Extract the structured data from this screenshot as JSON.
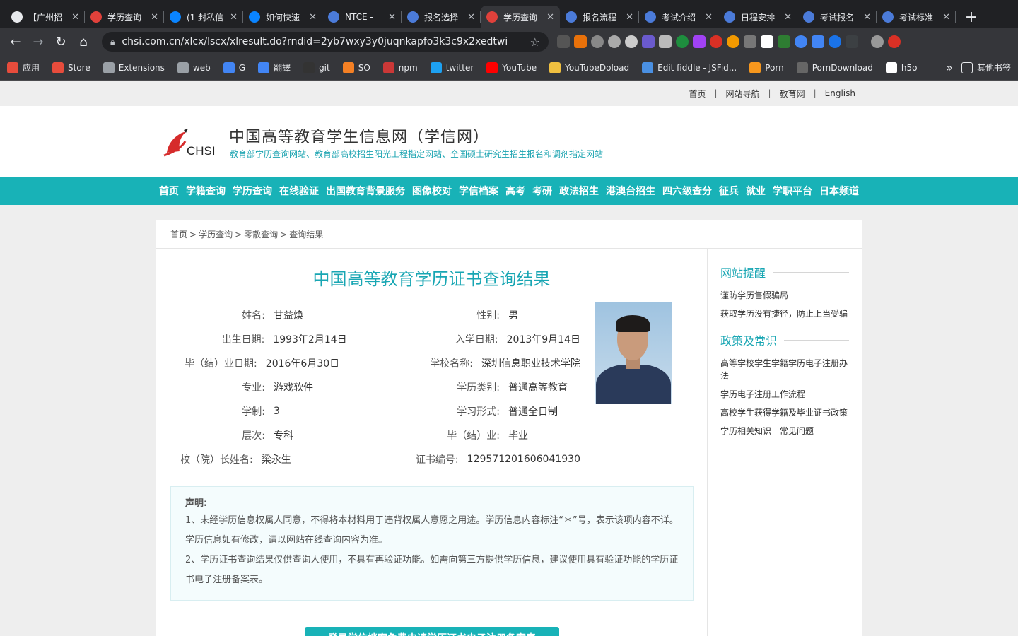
{
  "browser": {
    "tabs": [
      {
        "label": "【广州招",
        "icon": "58-icon",
        "color": "#e8eaed",
        "active": false
      },
      {
        "label": "学历查询",
        "icon": "chsi-icon",
        "color": "#e0413b",
        "active": false
      },
      {
        "label": "(1 封私信",
        "icon": "zhihu-icon",
        "color": "#0a84ff",
        "active": false
      },
      {
        "label": "如何快速",
        "icon": "zhihu-icon",
        "color": "#0a84ff",
        "active": false
      },
      {
        "label": "NTCE - ",
        "icon": "globe-icon",
        "color": "#4b7bd9",
        "active": false
      },
      {
        "label": "报名选择",
        "icon": "globe-icon",
        "color": "#4b7bd9",
        "active": false
      },
      {
        "label": "学历查询",
        "icon": "chsi-icon",
        "color": "#e0413b",
        "active": true
      },
      {
        "label": "报名流程",
        "icon": "globe-icon",
        "color": "#4b7bd9",
        "active": false
      },
      {
        "label": "考试介绍",
        "icon": "globe-icon",
        "color": "#4b7bd9",
        "active": false
      },
      {
        "label": "日程安排",
        "icon": "globe-icon",
        "color": "#4b7bd9",
        "active": false
      },
      {
        "label": "考试报名",
        "icon": "globe-icon",
        "color": "#4b7bd9",
        "active": false
      },
      {
        "label": "考试标准",
        "icon": "globe-icon",
        "color": "#4b7bd9",
        "active": false
      }
    ],
    "new_tab": "+",
    "url": "chsi.com.cn/xlcx/lscx/xlresult.do?rndid=2yb7wxy3y0juqnkapfo3k3c9x2xedtwi",
    "bookmarks": [
      {
        "label": "应用",
        "color": "#e74c3c"
      },
      {
        "label": "Store",
        "color": "#e74c3c"
      },
      {
        "label": "Extensions",
        "color": "#9aa0a6"
      },
      {
        "label": "web",
        "color": "#9aa0a6"
      },
      {
        "label": "G",
        "color": "#4285f4"
      },
      {
        "label": "翻譯",
        "color": "#4285f4"
      },
      {
        "label": "git",
        "color": "#333333"
      },
      {
        "label": "SO",
        "color": "#f48024"
      },
      {
        "label": "npm",
        "color": "#cb3837"
      },
      {
        "label": "twitter",
        "color": "#1da1f2"
      },
      {
        "label": "YouTube",
        "color": "#ff0000"
      },
      {
        "label": "YouTubeDoload",
        "color": "#f0c040"
      },
      {
        "label": "Edit fiddle - JSFid...",
        "color": "#4a90e2"
      },
      {
        "label": "Porn",
        "color": "#f7971d"
      },
      {
        "label": "PornDownload",
        "color": "#666666"
      },
      {
        "label": "h5o",
        "color": "#ffffff"
      }
    ],
    "bookmarks_more": "»",
    "other_bookmarks": "其他书签"
  },
  "site": {
    "top_links": [
      "首页",
      "网站导航",
      "教育网",
      "English"
    ],
    "logo_text": "CHSI",
    "title": "中国高等教育学生信息网（学信网）",
    "subtitle": "教育部学历查询网站、教育部高校招生阳光工程指定网站、全国硕士研究生招生报名和调剂指定网站",
    "nav": [
      "首页",
      "学籍查询",
      "学历查询",
      "在线验证",
      "出国教育背景服务",
      "图像校对",
      "学信档案",
      "高考",
      "考研",
      "政法招生",
      "港澳台招生",
      "四六级查分",
      "征兵",
      "就业",
      "学职平台",
      "日本频道"
    ],
    "accent": "#18b2b7"
  },
  "breadcrumb": [
    "首页",
    "学历查询",
    "零散查询",
    "查询结果"
  ],
  "result": {
    "title": "中国高等教育学历证书查询结果",
    "rows": [
      {
        "l1": "姓名:",
        "v1": "甘益焕",
        "l2": "性别:",
        "v2": "男"
      },
      {
        "l1": "出生日期:",
        "v1": "1993年2月14日",
        "l2": "入学日期:",
        "v2": "2013年9月14日"
      },
      {
        "l1": "毕（结）业日期:",
        "v1": "2016年6月30日",
        "l2": "学校名称:",
        "v2": "深圳信息职业技术学院"
      },
      {
        "l1": "专业:",
        "v1": "游戏软件",
        "l2": "学历类别:",
        "v2": "普通高等教育"
      },
      {
        "l1": "学制:",
        "v1": "3",
        "l2": "学习形式:",
        "v2": "普通全日制"
      },
      {
        "l1": "层次:",
        "v1": "专科",
        "l2": "毕（结）业:",
        "v2": "毕业"
      },
      {
        "l1": "校（院）长姓名:",
        "v1": "梁永生",
        "l2": "证书编号:",
        "v2": "129571201606041930"
      }
    ]
  },
  "notice": {
    "title": "声明:",
    "p1": "1、未经学历信息权属人同意，不得将本材料用于违背权属人意愿之用途。学历信息内容标注“＊”号，表示该项内容不详。学历信息如有修改，请以网站在线查询内容为准。",
    "p2": "2、学历证书查询结果仅供查询人使用，不具有再验证功能。如需向第三方提供学历信息，建议使用具有验证功能的学历证书电子注册备案表。"
  },
  "cta": "登录学信档案免费申请学历证书电子注册备案表",
  "sidebar": {
    "reminder_title": "网站提醒",
    "reminder_items": [
      "谨防学历售假骗局",
      "获取学历没有捷径，防止上当受骗"
    ],
    "policy_title": "政策及常识",
    "policy_items": [
      "高等学校学生学籍学历电子注册办法",
      "学历电子注册工作流程",
      "高校学生获得学籍及毕业证书政策"
    ],
    "policy_extra": [
      "学历相关知识",
      "常见问题"
    ]
  }
}
